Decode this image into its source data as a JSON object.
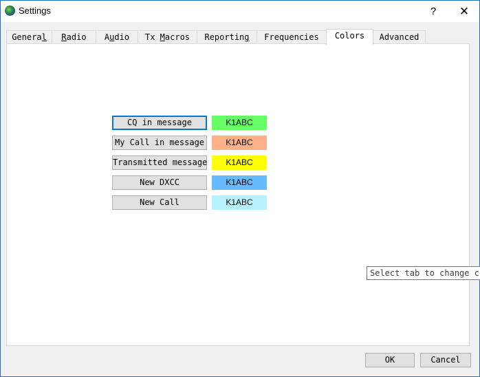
{
  "window": {
    "title": "Settings",
    "help_glyph": "?",
    "close_glyph": "✕"
  },
  "tabs": [
    {
      "label": "General",
      "mnemonic_index": 6
    },
    {
      "label": "Radio",
      "mnemonic_index": 0
    },
    {
      "label": "Audio",
      "mnemonic_index": 1
    },
    {
      "label": "Tx Macros",
      "mnemonic_index": 3
    },
    {
      "label": "Reporting",
      "mnemonic_index": 8
    },
    {
      "label": "Frequencies",
      "mnemonic_index": -1
    },
    {
      "label": "Colors",
      "mnemonic_index": -1,
      "active": true
    },
    {
      "label": "Advanced",
      "mnemonic_index": -1
    }
  ],
  "colors": [
    {
      "button": "CQ in message",
      "sample": "K1ABC",
      "color": "#66ff66"
    },
    {
      "button": "My Call in message",
      "sample": "K1ABC",
      "color": "#ffb18a"
    },
    {
      "button": "Transmitted message",
      "sample": "K1ABC",
      "color": "#ffff00"
    },
    {
      "button": "New DXCC",
      "sample": "K1ABC",
      "color": "#66bbff"
    },
    {
      "button": "New Call",
      "sample": "K1ABC",
      "color": "#b8f2ff"
    }
  ],
  "tooltip": "Select tab to change co",
  "footer": {
    "ok": "OK",
    "cancel": "Cancel"
  }
}
